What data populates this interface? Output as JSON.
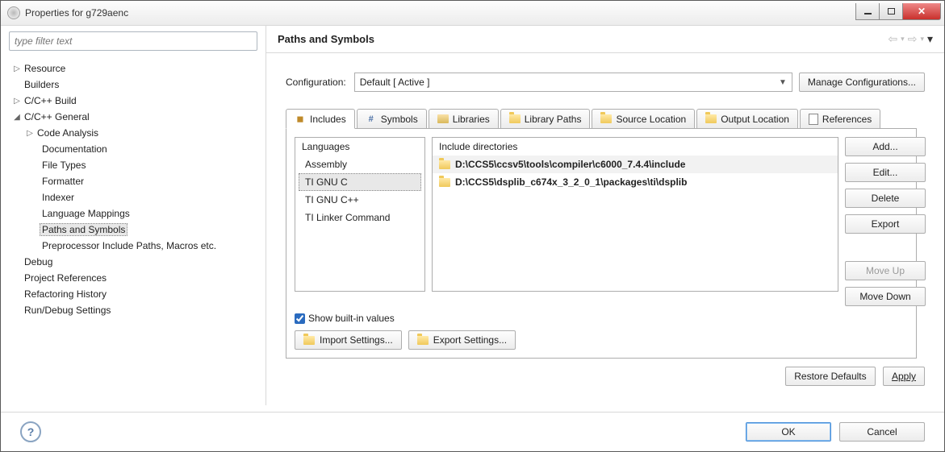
{
  "window_title": "Properties for g729aenc",
  "filter_placeholder": "type filter text",
  "tree": {
    "resource": "Resource",
    "builders": "Builders",
    "ccpp_build": "C/C++ Build",
    "ccpp_general": "C/C++ General",
    "code_analysis": "Code Analysis",
    "documentation": "Documentation",
    "file_types": "File Types",
    "formatter": "Formatter",
    "indexer": "Indexer",
    "lang_mappings": "Language Mappings",
    "paths_symbols": "Paths and Symbols",
    "preproc": "Preprocessor Include Paths, Macros etc.",
    "debug": "Debug",
    "proj_refs": "Project References",
    "refactor_hist": "Refactoring History",
    "run_debug": "Run/Debug Settings"
  },
  "page_title": "Paths and Symbols",
  "config_label": "Configuration:",
  "config_value": "Default  [ Active ]",
  "manage_config": "Manage Configurations...",
  "tabs": {
    "includes": "Includes",
    "symbols": "Symbols",
    "libraries": "Libraries",
    "library_paths": "Library Paths",
    "source_location": "Source Location",
    "output_location": "Output Location",
    "references": "References"
  },
  "languages_title": "Languages",
  "languages": [
    "Assembly",
    "TI GNU C",
    "TI GNU C++",
    "TI Linker Command"
  ],
  "includes_title": "Include directories",
  "include_dirs": [
    "D:\\CCS5\\ccsv5\\tools\\compiler\\c6000_7.4.4\\include",
    "D:\\CCS5\\dsplib_c674x_3_2_0_1\\packages\\ti\\dsplib"
  ],
  "side_buttons": {
    "add": "Add...",
    "edit": "Edit...",
    "delete": "Delete",
    "export": "Export",
    "move_up": "Move Up",
    "move_down": "Move Down"
  },
  "show_builtin": "Show built-in values",
  "import_settings": "Import Settings...",
  "export_settings": "Export Settings...",
  "restore_defaults": "Restore Defaults",
  "apply": "Apply",
  "ok": "OK",
  "cancel": "Cancel"
}
